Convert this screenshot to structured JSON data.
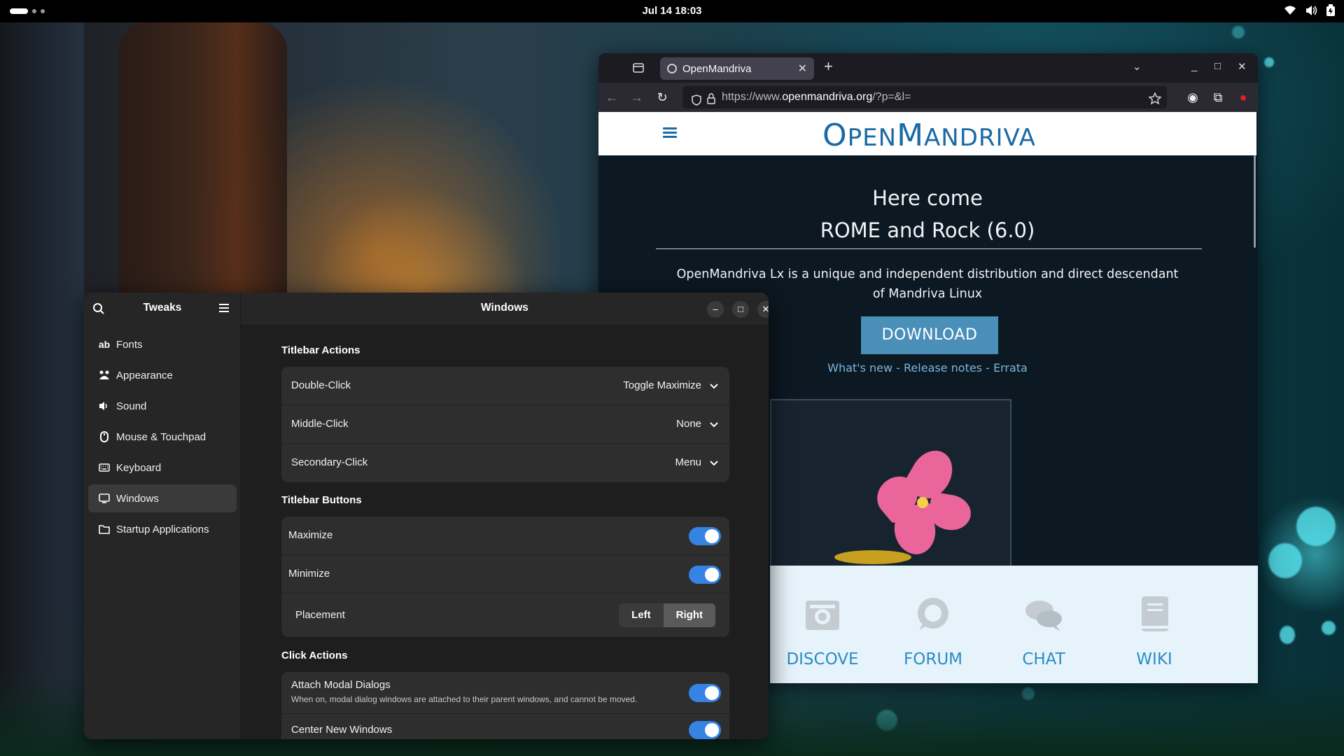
{
  "topbar": {
    "clock": "Jul 14  18:03"
  },
  "browser": {
    "tab_title": "OpenMandriva",
    "url_prefix": "https://www.",
    "url_host": "openmandriva.org",
    "url_path": "/?p=&l=",
    "site": {
      "logo_o": "O",
      "logo_pen": "PEN",
      "logo_m": "M",
      "logo_andriva": "ANDRIVA",
      "hero_line1": "Here come",
      "hero_line2": "ROME and Rock (6.0)",
      "description": "OpenMandriva Lx is a unique and independent distribution and direct descendant of Mandriva Linux",
      "download": "DOWNLOAD",
      "links": "What's new - Release notes - Errata",
      "features": [
        "DISCOVE",
        "FORUM",
        "CHAT",
        "WIKI"
      ]
    }
  },
  "tweaks": {
    "sidebar_title": "Tweaks",
    "title": "Windows",
    "nav": [
      {
        "icon": "ab",
        "label": "Fonts"
      },
      {
        "icon": "appearance",
        "label": "Appearance"
      },
      {
        "icon": "sound",
        "label": "Sound"
      },
      {
        "icon": "mouse",
        "label": "Mouse & Touchpad"
      },
      {
        "icon": "keyboard",
        "label": "Keyboard"
      },
      {
        "icon": "windows",
        "label": "Windows"
      },
      {
        "icon": "folder",
        "label": "Startup Applications"
      }
    ],
    "sections": {
      "titlebar_actions": "Titlebar Actions",
      "titlebar_buttons": "Titlebar Buttons",
      "click_actions": "Click Actions"
    },
    "actions": [
      {
        "label": "Double-Click",
        "value": "Toggle Maximize"
      },
      {
        "label": "Middle-Click",
        "value": "None"
      },
      {
        "label": "Secondary-Click",
        "value": "Menu"
      }
    ],
    "buttons": {
      "maximize": "Maximize",
      "maximize_on": true,
      "minimize": "Minimize",
      "minimize_on": true,
      "placement": "Placement",
      "left": "Left",
      "right": "Right",
      "placement_selected": "Right"
    },
    "click": {
      "attach_label": "Attach Modal Dialogs",
      "attach_desc": "When on, modal dialog windows are attached to their parent windows, and cannot be moved.",
      "attach_on": true,
      "center_label": "Center New Windows",
      "center_on": true
    }
  },
  "colors": {
    "accent": "#3584e4",
    "site_blue": "#1a6aa6",
    "download_bg": "#4a8fb8"
  }
}
